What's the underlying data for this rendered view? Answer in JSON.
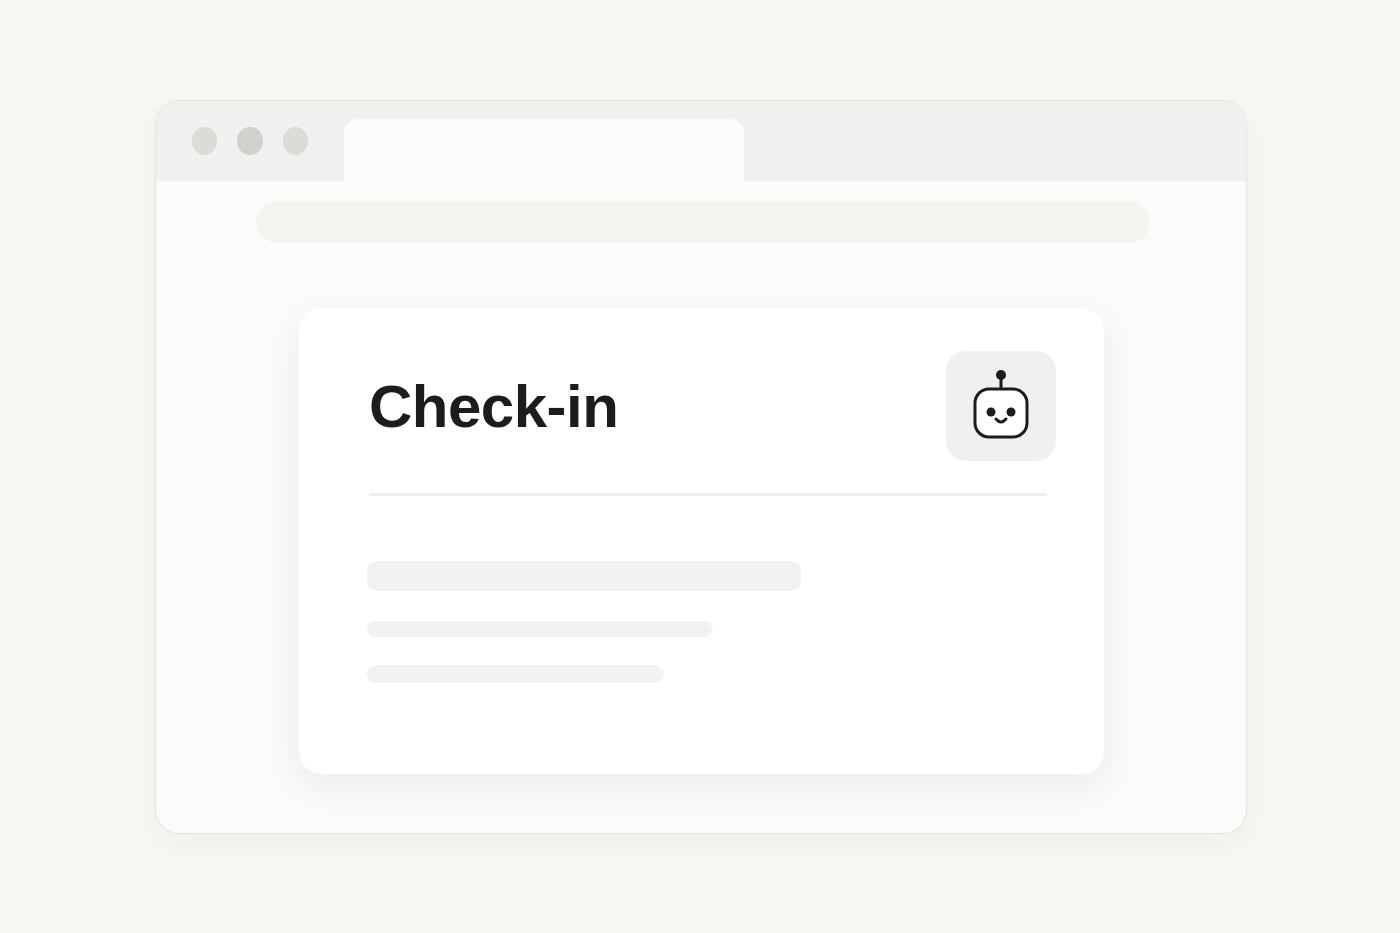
{
  "card": {
    "title": "Check-in"
  }
}
